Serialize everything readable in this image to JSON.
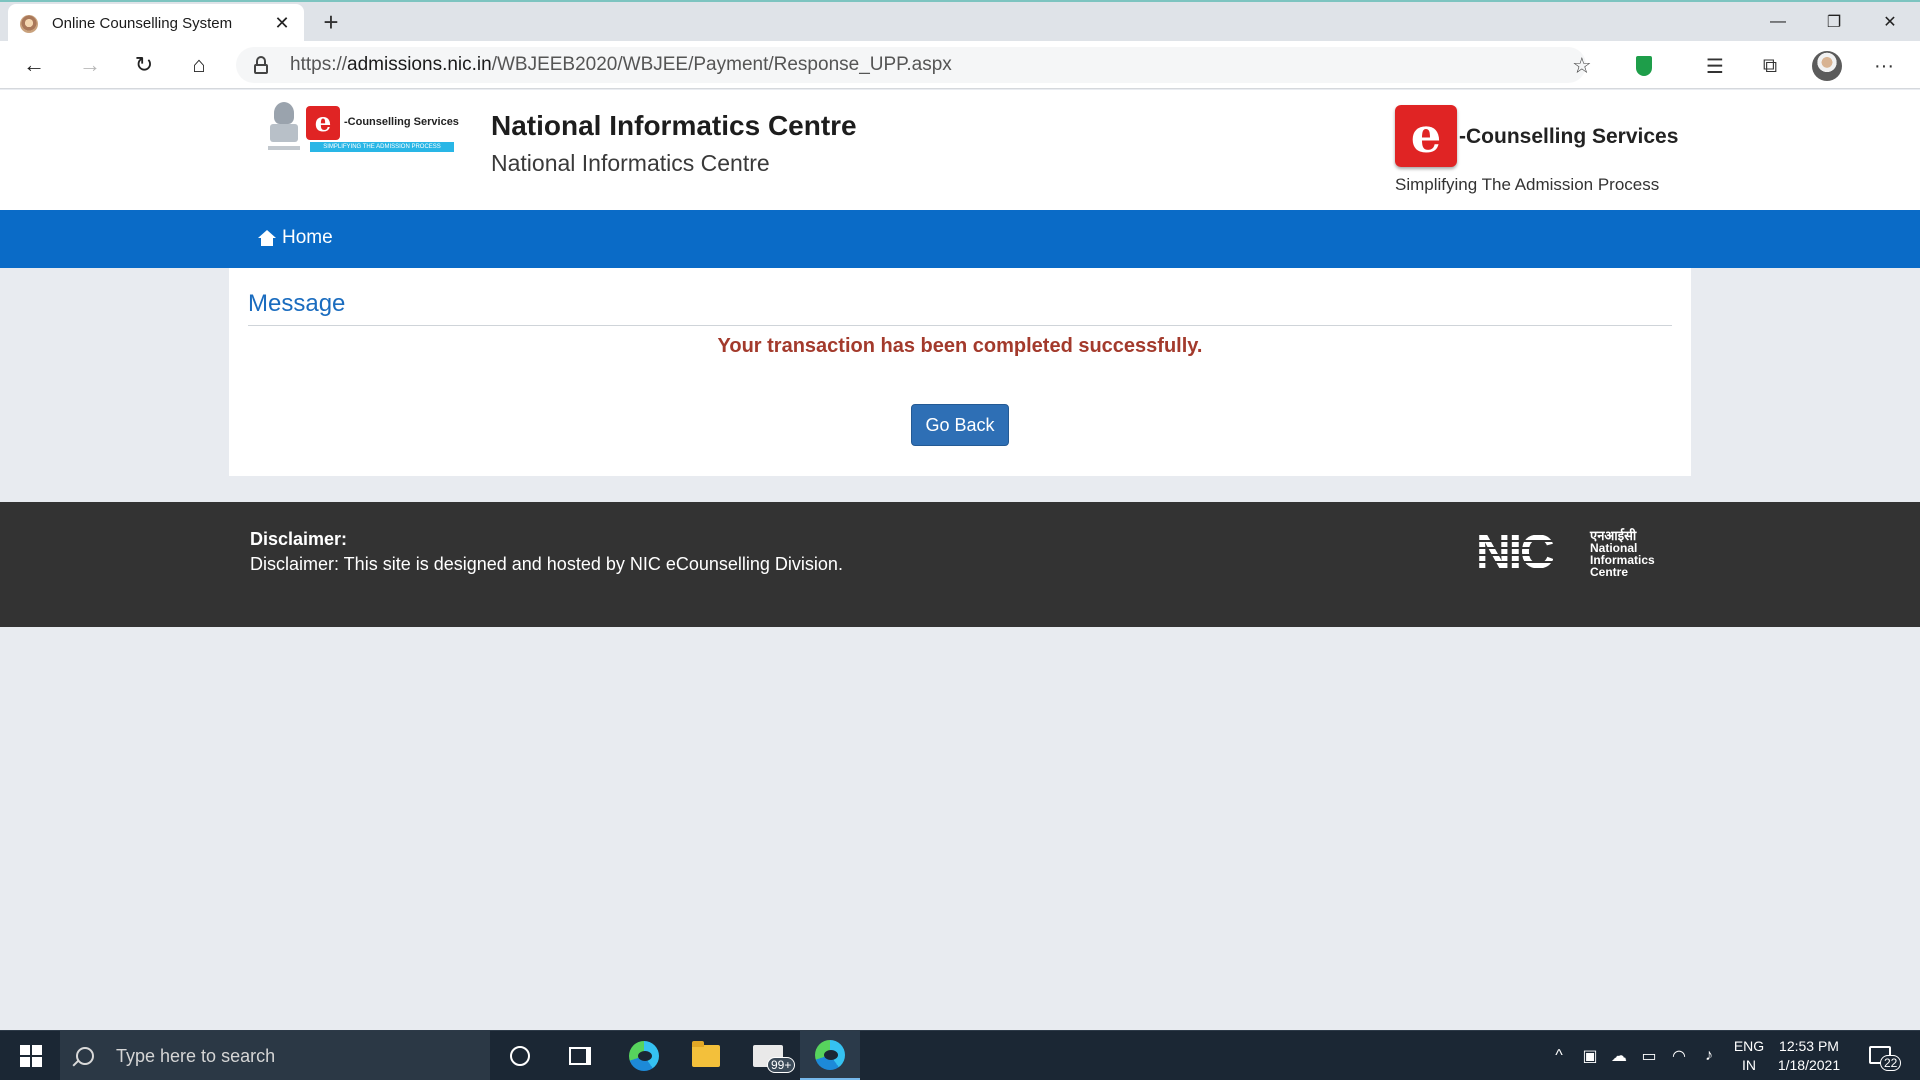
{
  "browser": {
    "tab_title": "Online Counselling System",
    "tab_close": "✕",
    "new_tab": "+",
    "url_prefix": "https://",
    "url_host": "admissions.nic.in",
    "url_path": "/WBJEEB2020/WBJEE/Payment/Response_UPP.aspx",
    "nav_icons": [
      "back-arrow-icon",
      "forward-arrow-icon",
      "refresh-icon",
      "home-icon"
    ],
    "window_controls": {
      "minimize": "—",
      "maximize": "❐",
      "close": "✕"
    },
    "toolbar_glyphs": {
      "back": "←",
      "forward": "→",
      "refresh": "↻",
      "home": "⌂",
      "star": "☆",
      "favorites": "☰",
      "collections": "⧉",
      "more": "···"
    }
  },
  "header": {
    "small_logo_name": "-Counselling Services",
    "small_logo_tag": "SIMPLIFYING THE ADMISSION PROCESS",
    "logo_letter": "e",
    "org_title": "National Informatics Centre",
    "org_subtitle": "National Informatics Centre",
    "big_logo_name": "-Counselling Services",
    "big_logo_tag": "Simplifying The Admission Process"
  },
  "nav": {
    "home_label": "Home"
  },
  "message_panel": {
    "title": "Message",
    "text": "Your transaction has been completed successfully.",
    "button_label": "Go Back"
  },
  "footer": {
    "disclaimer_title": "Disclaimer:",
    "disclaimer_text": "Disclaimer: This site is designed and hosted by NIC eCounselling Division.",
    "nic_logo": {
      "wordmark": "NIC",
      "hindi": "एनआईसी",
      "line1": "National",
      "line2": "Informatics",
      "line3": "Centre"
    }
  },
  "taskbar": {
    "search_placeholder": "Type here to search",
    "mail_badge": "99+",
    "tray_up": "^",
    "lang_line1": "ENG",
    "lang_line2": "IN",
    "time": "12:53 PM",
    "date": "1/18/2021",
    "notification_count": "22"
  },
  "colors": {
    "nav_blue": "#0a6bc7",
    "message_red": "#a33a2c",
    "button_blue": "#2e6fb5",
    "footer_dark": "#333333",
    "logo_red": "#e02424"
  }
}
